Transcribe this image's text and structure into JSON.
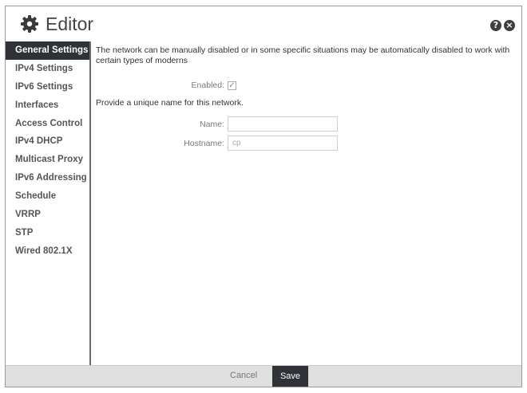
{
  "header": {
    "title": "Editor",
    "title_icon": "gear-icon",
    "help_icon": "?",
    "close_icon": "×"
  },
  "sidebar": {
    "items": [
      {
        "label": "General Settings",
        "active": true
      },
      {
        "label": "IPv4 Settings",
        "active": false
      },
      {
        "label": "IPv6 Settings",
        "active": false
      },
      {
        "label": "Interfaces",
        "active": false
      },
      {
        "label": "Access Control",
        "active": false
      },
      {
        "label": "IPv4 DHCP",
        "active": false
      },
      {
        "label": "Multicast Proxy",
        "active": false
      },
      {
        "label": "IPv6 Addressing",
        "active": false
      },
      {
        "label": "Schedule",
        "active": false
      },
      {
        "label": "VRRP",
        "active": false
      },
      {
        "label": "STP",
        "active": false
      },
      {
        "label": "Wired 802.1X",
        "active": false
      }
    ]
  },
  "main": {
    "description": "The network can be manually disabled or in some specific situations may be automatically disabled to work with certain types of moderns",
    "enabled_label": "Enabled:",
    "enabled_checked": true,
    "enabled_mark": "✓",
    "provide_text": "Provide a unique name for this network.",
    "name_label": "Name:",
    "name_value": "",
    "hostname_label": "Hostname:",
    "hostname_placeholder": "cp"
  },
  "footer": {
    "cancel_label": "Cancel",
    "save_label": "Save"
  },
  "colors": {
    "active_nav_bg": "#2f3237",
    "footer_bg": "#e0e0e0",
    "save_bg": "#2f3237"
  }
}
